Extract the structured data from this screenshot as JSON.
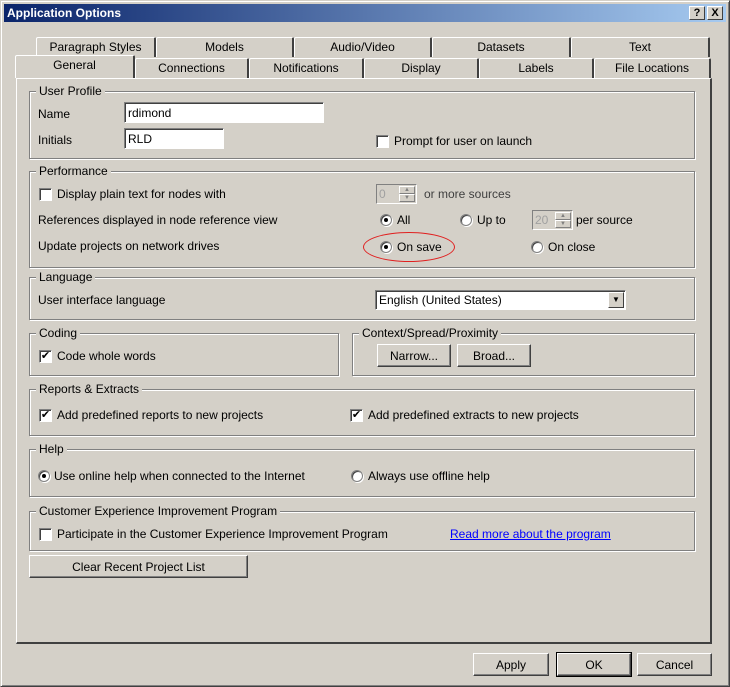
{
  "window": {
    "title": "Application Options",
    "help_button": "?",
    "close_button": "X"
  },
  "tabs": {
    "row1": [
      {
        "label": "Paragraph Styles"
      },
      {
        "label": "Models"
      },
      {
        "label": "Audio/Video"
      },
      {
        "label": "Datasets"
      },
      {
        "label": "Text"
      }
    ],
    "row2": [
      {
        "label": "General",
        "selected": true
      },
      {
        "label": "Connections"
      },
      {
        "label": "Notifications"
      },
      {
        "label": "Display"
      },
      {
        "label": "Labels"
      },
      {
        "label": "File Locations"
      }
    ]
  },
  "user_profile": {
    "title": "User Profile",
    "name_label": "Name",
    "name_value": "rdimond",
    "initials_label": "Initials",
    "initials_value": "RLD",
    "prompt_label": "Prompt for user on launch",
    "prompt_checked": false
  },
  "performance": {
    "title": "Performance",
    "plain_text_label": "Display plain text for nodes with",
    "plain_text_checked": false,
    "sources_value": "0",
    "sources_suffix": "or more sources",
    "references_label": "References displayed in node reference view",
    "all_label": "All",
    "upto_label": "Up to",
    "upto_value": "20",
    "per_source_label": "per source",
    "references_selected": "All",
    "update_label": "Update projects on network drives",
    "on_save_label": "On save",
    "on_close_label": "On close",
    "update_selected": "On save",
    "highlight_color": "#e02020"
  },
  "language": {
    "title": "Language",
    "ui_language_label": "User interface language",
    "ui_language_value": "English (United States)"
  },
  "coding": {
    "title": "Coding",
    "whole_words_label": "Code whole words",
    "whole_words_checked": true
  },
  "context": {
    "title": "Context/Spread/Proximity",
    "narrow_label": "Narrow...",
    "broad_label": "Broad..."
  },
  "reports": {
    "title": "Reports & Extracts",
    "reports_label": "Add predefined reports to new projects",
    "reports_checked": true,
    "extracts_label": "Add predefined extracts to new projects",
    "extracts_checked": true
  },
  "help": {
    "title": "Help",
    "online_label": "Use online help when connected to the Internet",
    "offline_label": "Always use offline help",
    "selected": "online"
  },
  "ceip": {
    "title": "Customer Experience Improvement Program",
    "participate_label": "Participate in the Customer Experience Improvement Program",
    "participate_checked": false,
    "read_more_link": "Read more about the program",
    "link_color": "#0000ff"
  },
  "clear_recent_label": "Clear Recent Project List",
  "footer": {
    "apply_label": "Apply",
    "ok_label": "OK",
    "cancel_label": "Cancel"
  },
  "icons": {
    "check": "✔",
    "dropdown": "▼",
    "spin_up": "▲",
    "spin_down": "▼"
  }
}
